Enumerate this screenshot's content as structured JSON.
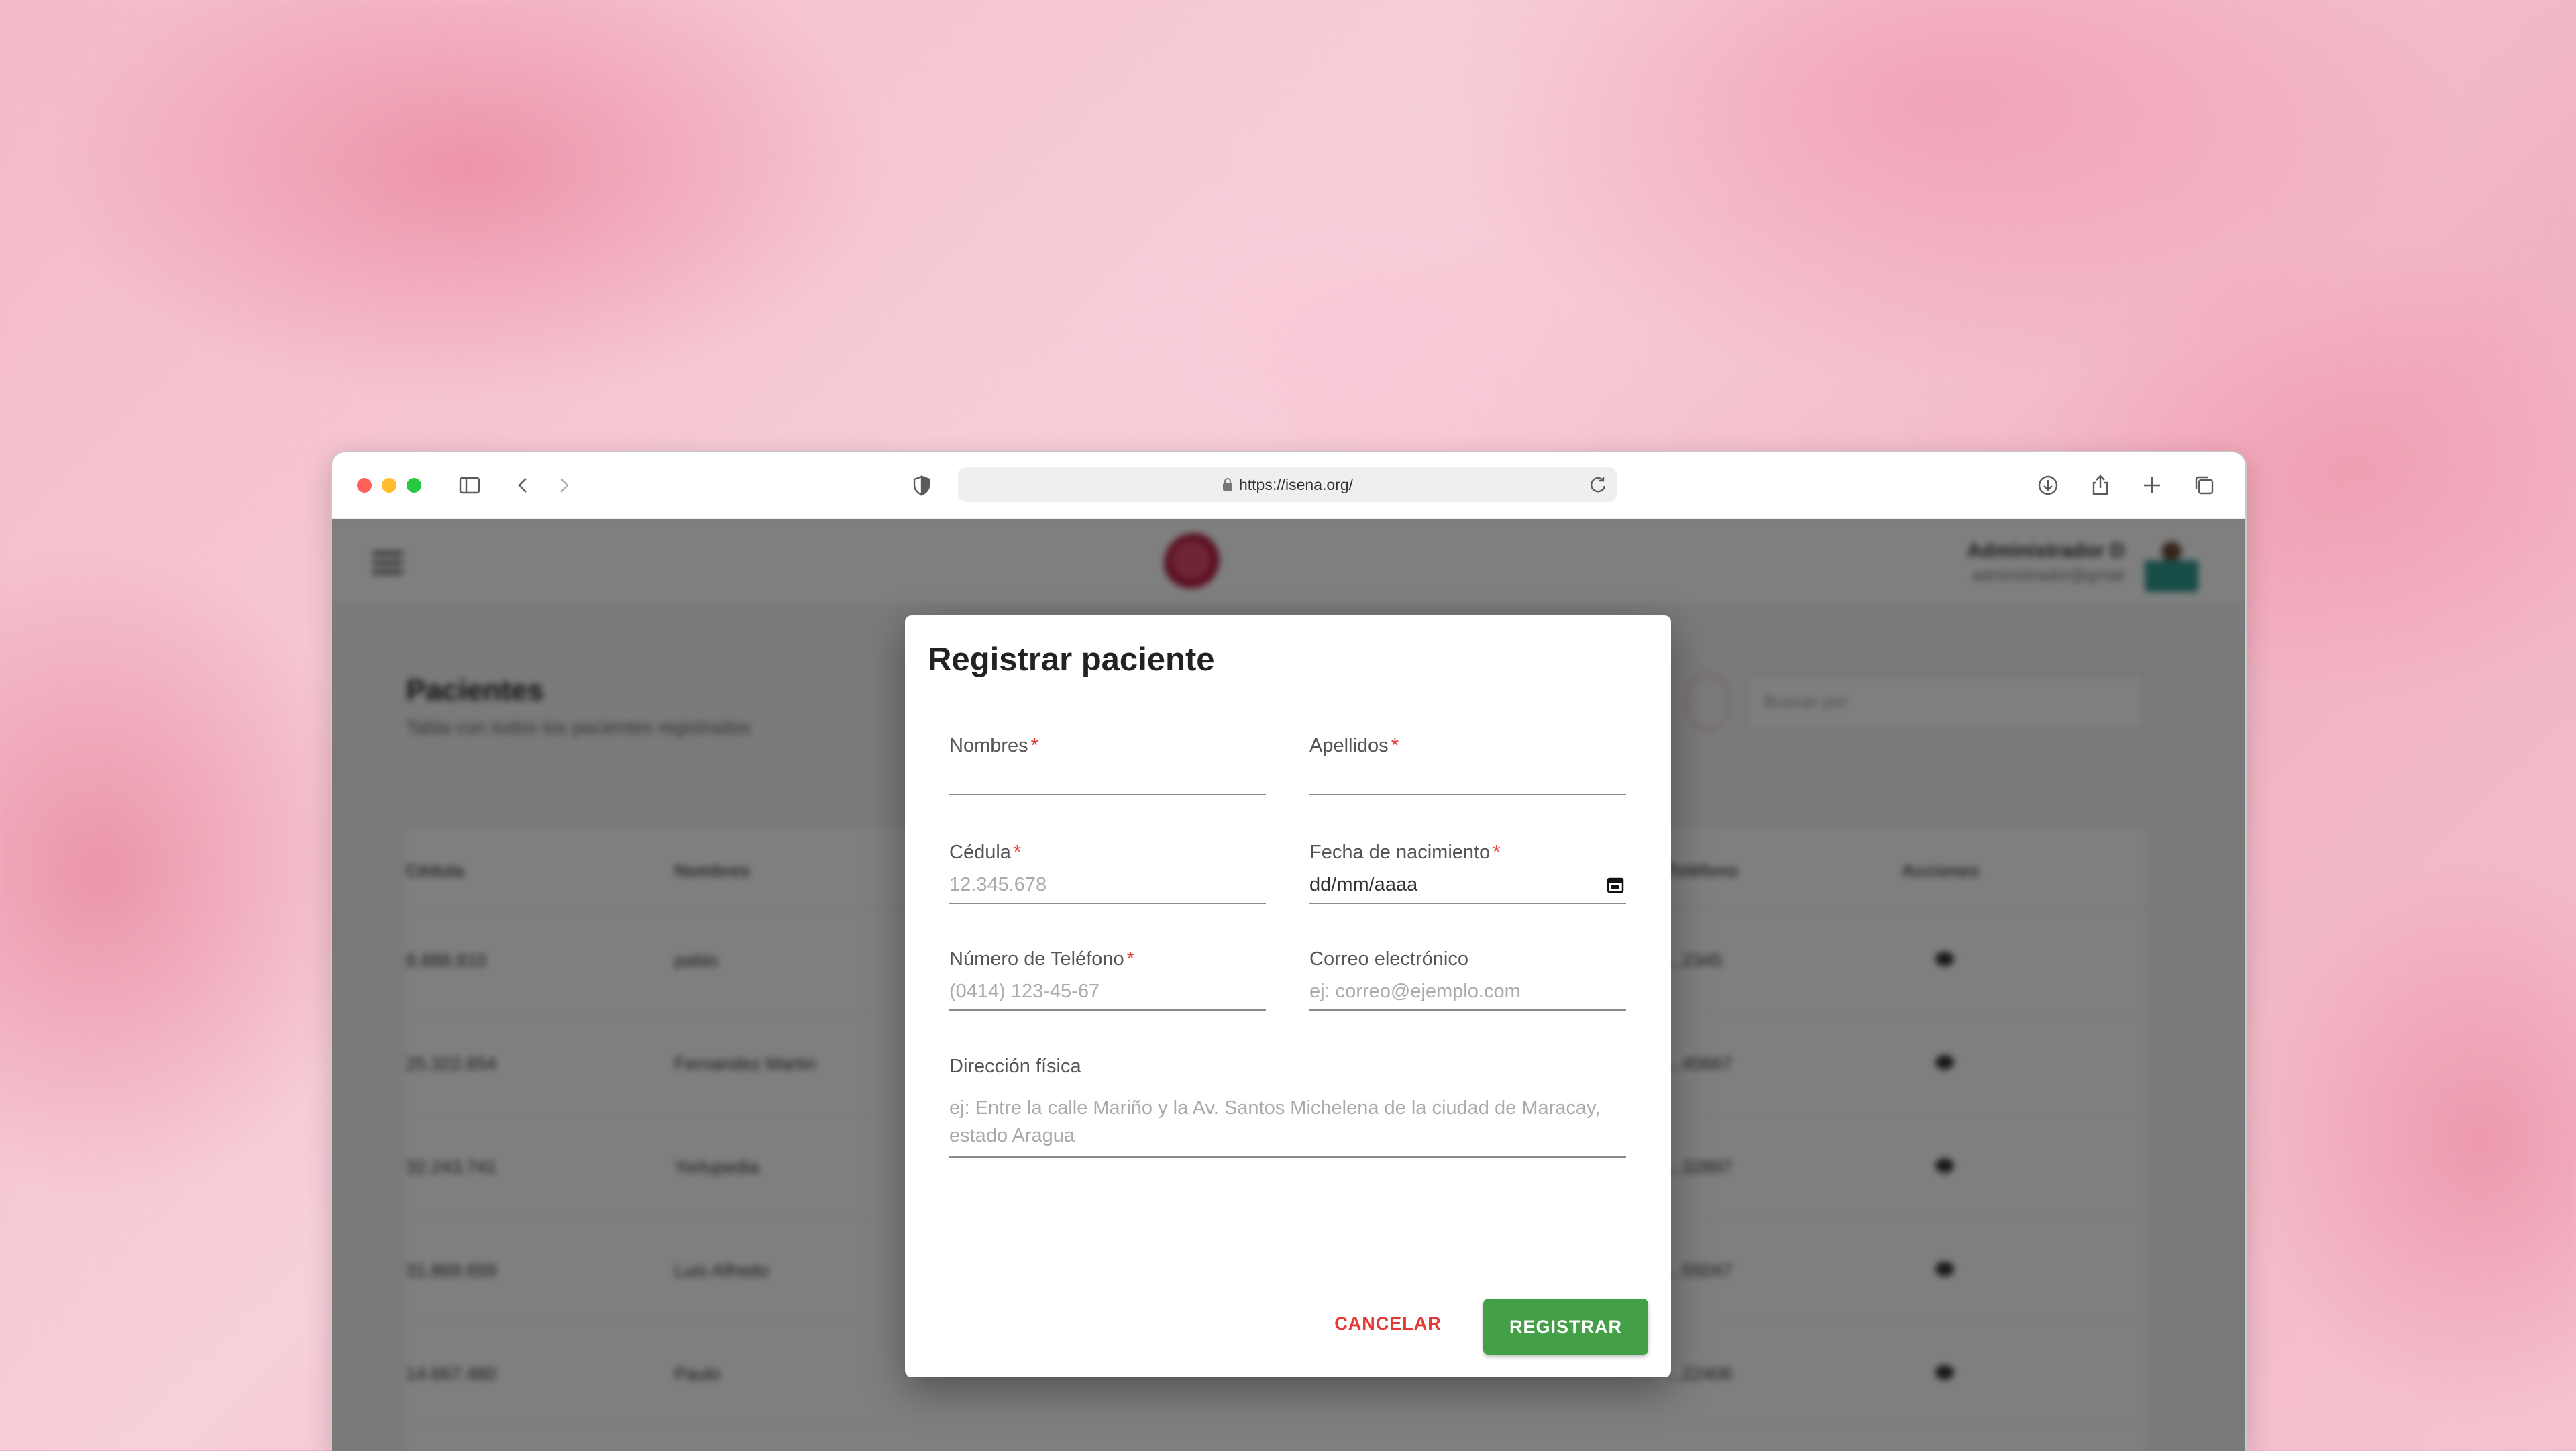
{
  "browser": {
    "url": "https://isena.org/"
  },
  "background_page": {
    "user_name": "Administrador D",
    "user_email": "administrador@gmail",
    "title": "Pacientes",
    "subtitle": "Tabla con todos los pacientes registrados",
    "search_placeholder": "Buscar por",
    "columns": [
      "Cédula",
      "Nombres",
      "Teléfono",
      "Acciones"
    ],
    "rows": [
      {
        "cedula": "8.888.810",
        "nombre": "pablo",
        "telefono": "...2345"
      },
      {
        "cedula": "25.322.654",
        "nombre": "Fernandez Martin",
        "telefono": "...45667"
      },
      {
        "cedula": "32.243.741",
        "nombre": "Yorlupedia",
        "telefono": "...32897"
      },
      {
        "cedula": "31.869.659",
        "nombre": "Luis Alfredo",
        "telefono": "...55047"
      },
      {
        "cedula": "14.667.480",
        "nombre": "Paulo",
        "telefono": "...22406"
      }
    ]
  },
  "modal": {
    "title": "Registrar paciente",
    "required_mark": "*",
    "fields": {
      "nombres": {
        "label": "Nombres",
        "placeholder": ""
      },
      "apellidos": {
        "label": "Apellidos",
        "placeholder": ""
      },
      "cedula": {
        "label": "Cédula",
        "placeholder": "12.345.678"
      },
      "fecha": {
        "label": "Fecha de nacimiento",
        "value": "dd/mm/aaaa"
      },
      "telefono": {
        "label": "Número de Teléfono",
        "placeholder": "(0414) 123-45-67"
      },
      "correo": {
        "label": "Correo electrónico",
        "placeholder": "ej: correo@ejemplo.com"
      },
      "direccion": {
        "label": "Dirección física",
        "placeholder": "ej: Entre la calle Mariño y la Av. Santos Michelena de la ciudad de Maracay, estado Aragua"
      }
    },
    "cancel_label": "CANCELAR",
    "register_label": "REGISTRAR"
  },
  "colors": {
    "accent_green": "#43a047",
    "cancel_red": "#e53935"
  }
}
